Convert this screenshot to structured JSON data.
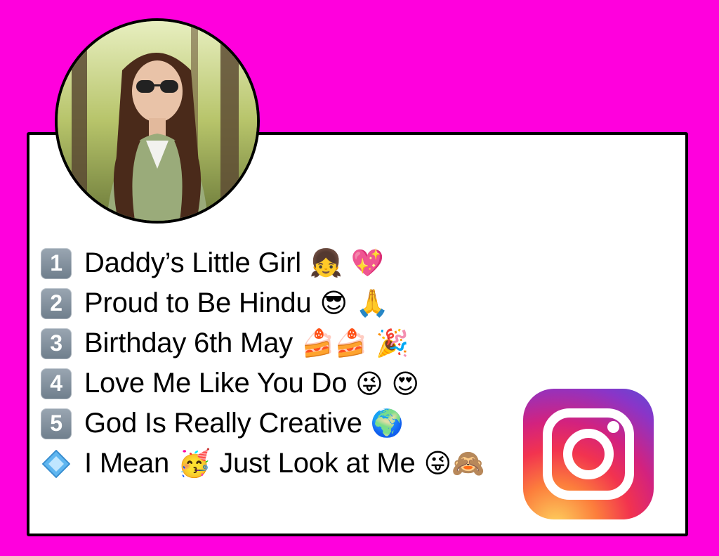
{
  "lines": [
    {
      "marker": "1",
      "text": "Daddy’s Little Girl",
      "emoji": "👧 💖"
    },
    {
      "marker": "2",
      "text": "Proud to Be Hindu",
      "emoji": "😎 🙏"
    },
    {
      "marker": "3",
      "text": "Birthday 6th May",
      "emoji": "🍰🍰 🎉"
    },
    {
      "marker": "4",
      "text": "Love Me Like You Do",
      "emoji": "😜 😍"
    },
    {
      "marker": "5",
      "text": "God Is Really Creative",
      "emoji": "🌍"
    },
    {
      "marker": "diamond",
      "text_a": "I Mean",
      "emoji_a": "🥳",
      "text_b": "Just Look at Me",
      "emoji_b": "😜🙈"
    }
  ],
  "icons": {
    "profile": "profile-photo",
    "logo": "instagram-logo-icon",
    "bullet_6": "blue-diamond-icon"
  },
  "colors": {
    "background": "#ff00dd",
    "card": "#ffffff",
    "border": "#000000"
  }
}
